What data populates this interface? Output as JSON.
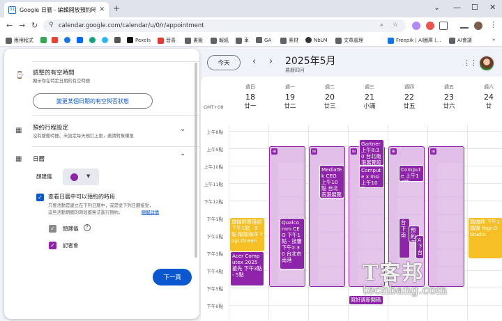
{
  "browser": {
    "tab_title": "Google 日曆 - 編輯開放預約時段",
    "url": "calendar.google.com/calendar/u/0/r/appointment",
    "bookmarks": [
      "應用程式",
      "Pexels",
      "音喜",
      "書籤",
      "報紙",
      "車",
      "GA",
      "素材",
      "NbLM",
      "文章處理",
      "Freepik | AI圖庫 (...",
      "AI會議"
    ]
  },
  "panel": {
    "section1_title": "調整的有空時間",
    "section1_sub": "顯示你在特定日期的有空時間",
    "change_avail_button": "變更某個日期的有空與否狀態",
    "section2_title": "預約行程設定",
    "section2_sub": "沒有緩衝時間、未設定每天預訂上限，邀請對象權限",
    "section3_title": "日曆",
    "color_label": "顏建儀",
    "check_main": "查看日曆中可以預約的時段",
    "check_desc1": "只要活動是建立在下列日曆中，或是從下列日曆接受，",
    "check_desc2": "這些活動期間的時段都無法進行預約。",
    "learn_more": "瞭解詳情",
    "cal1": "顏建儀",
    "cal2": "記者會",
    "next_button": "下一頁",
    "colors": {
      "accent": "#0b57d0",
      "calendar": "#8e24aa"
    }
  },
  "calendar": {
    "today_button": "今天",
    "month": "2025年5月",
    "lunar_month": "農曆四月",
    "timezone": "GMT+08",
    "days": [
      {
        "name": "週日",
        "date": "18",
        "lunar": "廿一"
      },
      {
        "name": "週一",
        "date": "19",
        "lunar": "廿二"
      },
      {
        "name": "週二",
        "date": "20",
        "lunar": "廿三"
      },
      {
        "name": "週三",
        "date": "21",
        "lunar": "小滿"
      },
      {
        "name": "週四",
        "date": "22",
        "lunar": "廿五"
      },
      {
        "name": "週五",
        "date": "23",
        "lunar": "廿六"
      },
      {
        "name": "週六",
        "date": "24",
        "lunar": "廿"
      }
    ],
    "hours": [
      "上午8點",
      "上午9點",
      "上午10點",
      "上午11點",
      "下午12點",
      "下午1點",
      "下午2點",
      "下午3點",
      "下午4點",
      "下午5點",
      "下午6點"
    ],
    "events": {
      "e1": "瑜伽師資培訓 下午1點 - 5點 瑜珈海洋 Yogi Ocean",
      "e2": "Acer Computex 2025 搶先 下午3點 - 5點",
      "e3": "MediaTek CEO 上午10點 台北南港展覽館2",
      "e4": "Qualcomm CEO 下午1點 - 技審 下午2:30 台北市南港",
      "e5": "Gartner 上午8:30 台北南港展覽館2",
      "e6": "Compute x msi 上午10點",
      "e7": "寫好週新聞稿",
      "e8": "Compute 上午10點",
      "e9": "台 下 南",
      "e10": "預約 下",
      "e11": "A 下 台",
      "e12": "瑜伽師 下午1 瑜珈 Yogi O Studio"
    },
    "watermark_cn": "T客邦",
    "watermark_en": "techbang.com"
  }
}
